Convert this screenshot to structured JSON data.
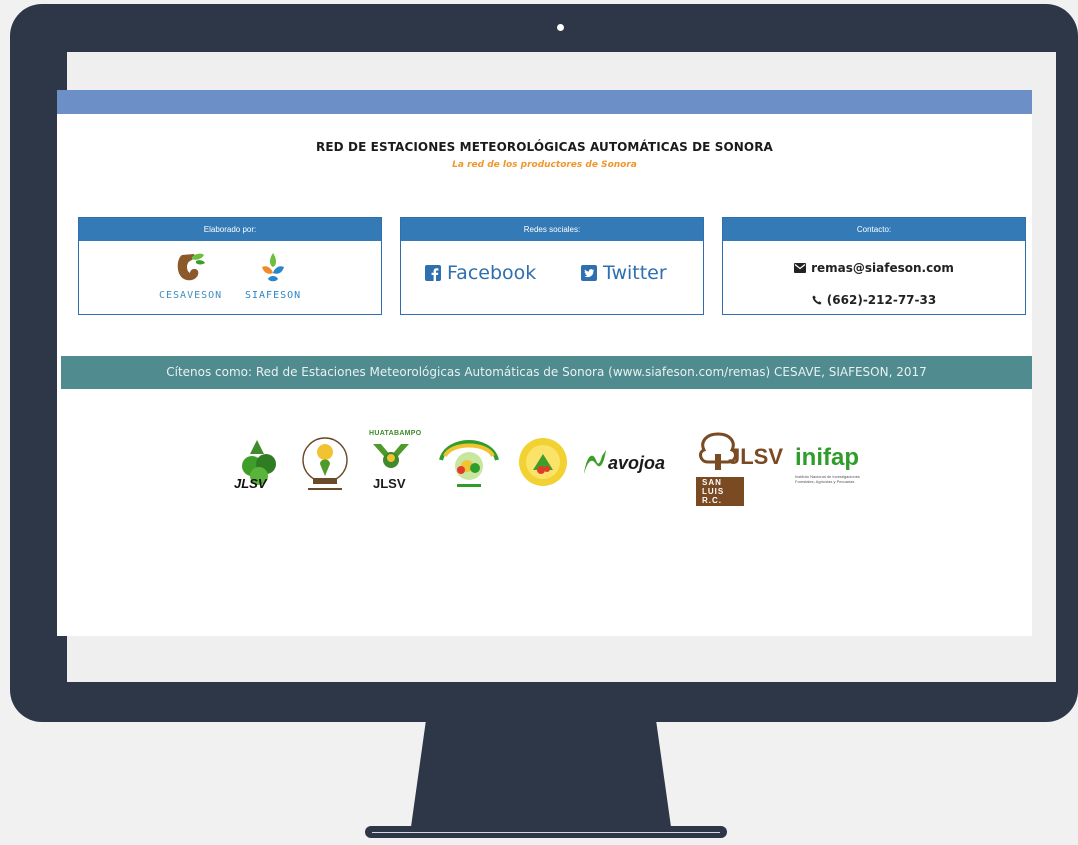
{
  "header": {
    "title": "RED DE ESTACIONES METEOROLÓGICAS AUTOMÁTICAS DE SONORA",
    "subtitle": "La red de los productores de Sonora"
  },
  "panels": {
    "elaborado": {
      "heading": "Elaborado por:",
      "logos": [
        {
          "name": "CESAVESON",
          "icon": "cesaveson-logo"
        },
        {
          "name": "SIAFESON",
          "icon": "siafeson-logo"
        }
      ]
    },
    "redes": {
      "heading": "Redes sociales:",
      "links": [
        {
          "label": "Facebook",
          "icon": "facebook-icon"
        },
        {
          "label": "Twitter",
          "icon": "twitter-icon"
        }
      ]
    },
    "contacto": {
      "heading": "Contacto:",
      "email": "remas@siafeson.com",
      "phone": "(662)-212-77-33"
    }
  },
  "citation": "Cítenos como: Red de Estaciones Meteorológicas Automáticas de Sonora (www.siafeson.com/remas) CESAVE, SIAFESON, 2017",
  "partners": [
    {
      "label": "JLSV",
      "icon": "jlsv-trees-logo"
    },
    {
      "label": "",
      "icon": "jlsv-hermosillo-logo"
    },
    {
      "label": "HUATABAMPO",
      "sub": "JLSV",
      "icon": "huatabampo-logo"
    },
    {
      "label": "",
      "icon": "comite-sanidad-logo"
    },
    {
      "label": "",
      "icon": "comite-hortalizas-logo"
    },
    {
      "label": "avojoa",
      "icon": "navojoa-logo"
    },
    {
      "label": "JLSV",
      "sub": "SAN LUIS R.C.",
      "icon": "jlsv-san-luis-logo"
    },
    {
      "label": "inifap",
      "sub": "Instituto Nacional de Investigaciones Forestales, Agrícolas y Pecuarias",
      "icon": "inifap-logo"
    }
  ],
  "colors": {
    "frame": "#2e3748",
    "topbar": "#6b8fc6",
    "panel_header": "#337ab7",
    "citation_bar": "#4f8b8f",
    "subtitle": "#f0962c"
  }
}
